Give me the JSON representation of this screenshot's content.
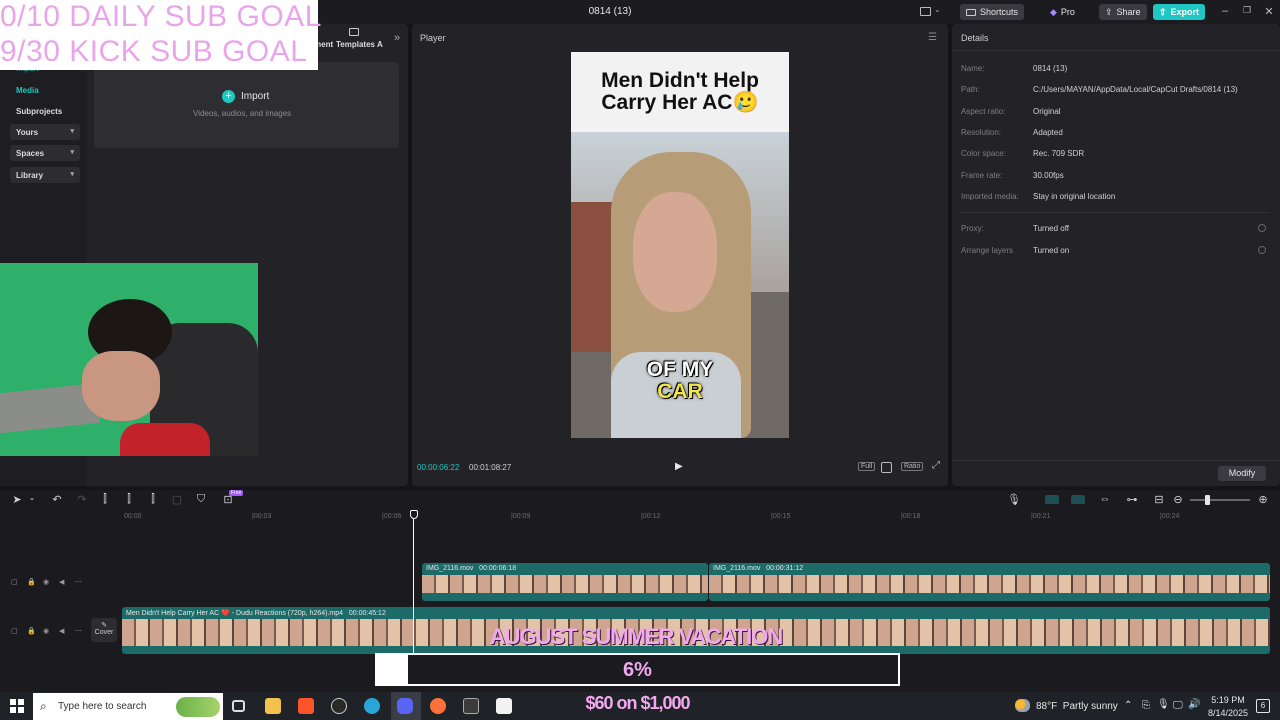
{
  "overlays": {
    "daily_goal": "0/10 DAILY SUB GOAL",
    "kick_goal": "9/30 KICK SUB GOAL",
    "progress_banner": "AUGUST SUMMER VACATION",
    "progress_percent": "6%",
    "progress_fraction": 0.06,
    "money_goal": "$60 on $1,000"
  },
  "topbar": {
    "title": "0814 (13)",
    "shortcuts": "Shortcuts",
    "pro": "Pro",
    "share": "Share",
    "export": "Export"
  },
  "media_tabs": {
    "element": "ment",
    "templates": "Templates",
    "a": "A"
  },
  "sidebar": {
    "import": "Import",
    "items": [
      {
        "label": "Media"
      },
      {
        "label": "Subprojects"
      },
      {
        "label": "Yours"
      },
      {
        "label": "Spaces"
      },
      {
        "label": "Library"
      }
    ]
  },
  "import_box": {
    "label": "Import",
    "hint": "Videos, audios, and images"
  },
  "player": {
    "title": "Player",
    "video_title": "Men Didn't Help Carry Her AC🥲",
    "caption_line1": "OF MY",
    "caption_line2": "CAR",
    "current_time": "00:00:06:22",
    "total_time": "00:01:08:27",
    "full": "Full",
    "ratio": "Ratio"
  },
  "details": {
    "title": "Details",
    "rows": [
      {
        "label": "Name:",
        "value": "0814 (13)"
      },
      {
        "label": "Path:",
        "value": "C:/Users/MAYAN/AppData/Local/CapCut Drafts/0814 (13)"
      },
      {
        "label": "Aspect ratio:",
        "value": "Original"
      },
      {
        "label": "Resolution:",
        "value": "Adapted"
      },
      {
        "label": "Color space:",
        "value": "Rec. 709 SDR"
      },
      {
        "label": "Frame rate:",
        "value": "30.00fps"
      },
      {
        "label": "Imported media:",
        "value": "Stay in original location"
      },
      {
        "label": "Proxy:",
        "value": "Turned off"
      },
      {
        "label": "Arrange layers",
        "value": "Turned on"
      }
    ],
    "modify": "Modify"
  },
  "timeline": {
    "free_badge": "Free",
    "ticks": [
      "00:00",
      "|00:03",
      "|00:06",
      "|00:09",
      "|00:12",
      "|00:15",
      "|00:18",
      "|00:21",
      "|00:24"
    ],
    "clip_a1": "IMG_2116.mov   00:00:06:18",
    "clip_a2": "IMG_2116.mov   00:00:31:12",
    "clip_main": "Men Didn't Help Carry Her AC ❤️ - Dudu Reactions (720p, h264).mp4   00:00:45:12",
    "cover": "Cover"
  },
  "taskbar": {
    "search_placeholder": "Type here to search",
    "weather": "88°F  Partly sunny",
    "time": "5:19 PM",
    "date": "8/14/2025",
    "notification_count": "6"
  }
}
